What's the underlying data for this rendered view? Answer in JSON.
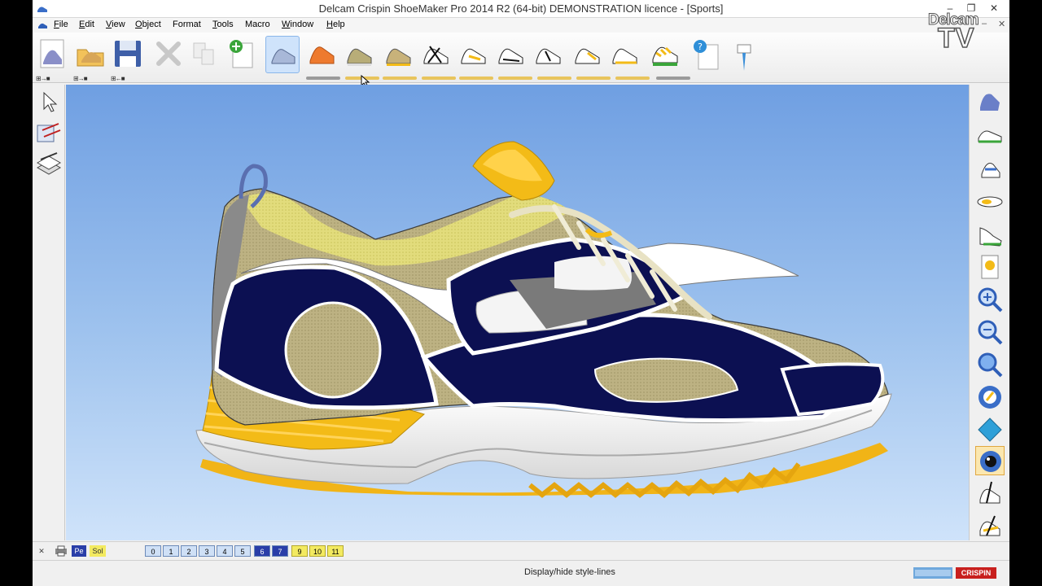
{
  "window": {
    "title": "Delcam Crispin ShoeMaker Pro 2014 R2 (64-bit) DEMONSTRATION licence - [Sports]",
    "minimize": "–",
    "maximize": "❐",
    "close": "✕"
  },
  "menu": {
    "items": [
      {
        "underline": "F",
        "rest": "ile"
      },
      {
        "underline": "E",
        "rest": "dit"
      },
      {
        "underline": "V",
        "rest": "iew"
      },
      {
        "underline": "O",
        "rest": "bject"
      },
      {
        "underline": "",
        "rest": "Format"
      },
      {
        "underline": "T",
        "rest": "ools"
      },
      {
        "underline": "",
        "rest": "Macro"
      },
      {
        "underline": "W",
        "rest": "indow"
      },
      {
        "underline": "H",
        "rest": "elp"
      }
    ],
    "mdi_minimize": "–",
    "mdi_close": "✕"
  },
  "toolbar": {
    "arrows": [
      "⊞→■",
      "⊞→■",
      "⊞←■"
    ]
  },
  "layers": {
    "tags": [
      "Pe",
      "Sol"
    ],
    "numbers": [
      "0",
      "1",
      "2",
      "3",
      "4",
      "5",
      "6",
      "7",
      "9",
      "10",
      "11"
    ],
    "close": "✕"
  },
  "status": {
    "text": "Display/hide style-lines",
    "brand": "CRISPIN"
  },
  "watermark": {
    "line1": "Delcam",
    "line2": "TV"
  },
  "colors": {
    "navy": "#0c1052",
    "mesh": "#b8ad78",
    "gold": "#f3bb17",
    "sky": "#8fb6eb"
  }
}
